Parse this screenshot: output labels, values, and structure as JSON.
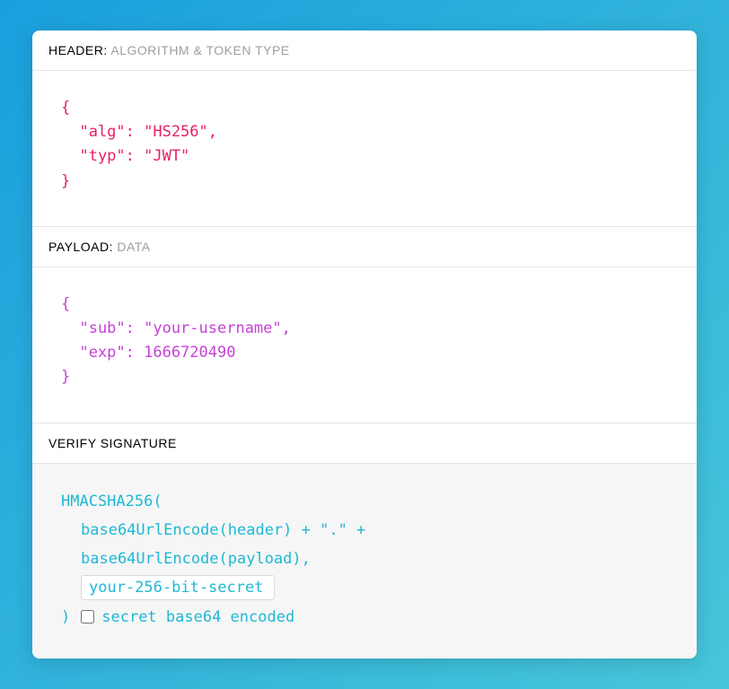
{
  "header_section": {
    "title": "HEADER:",
    "subtitle": "ALGORITHM & TOKEN TYPE",
    "code": "{\n  \"alg\": \"HS256\",\n  \"typ\": \"JWT\"\n}"
  },
  "payload_section": {
    "title": "PAYLOAD:",
    "subtitle": "DATA",
    "code": "{\n  \"sub\": \"your-username\",\n  \"exp\": 1666720490\n}"
  },
  "signature_section": {
    "title": "VERIFY SIGNATURE",
    "line1": "HMACSHA256(",
    "line2": "base64UrlEncode(header) + \".\" +",
    "line3": "base64UrlEncode(payload),",
    "secret_value": "your-256-bit-secret",
    "close_paren": ")",
    "checkbox_label": "secret base64 encoded",
    "checkbox_checked": false
  }
}
